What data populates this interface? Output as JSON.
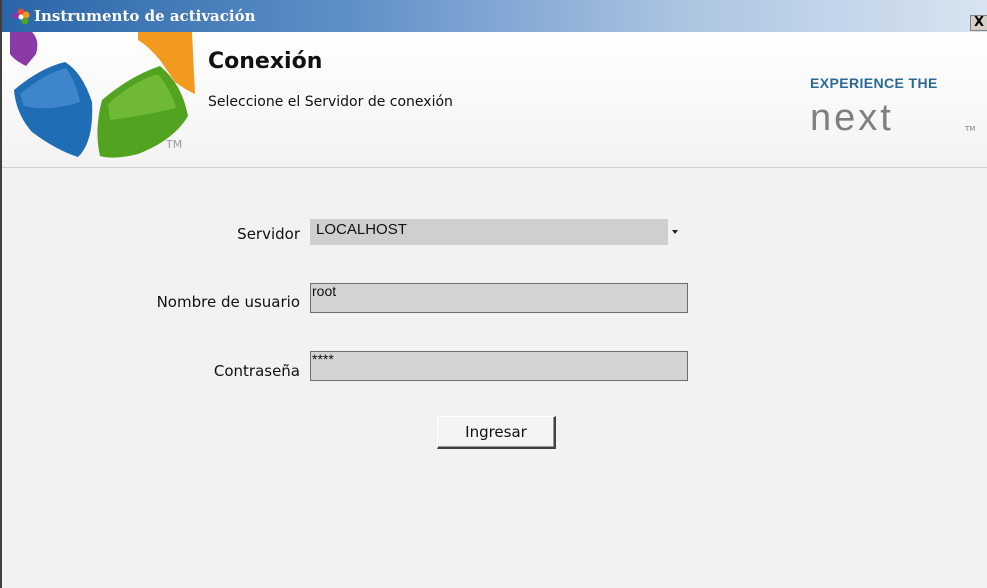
{
  "window": {
    "title": "Instrumento de activación",
    "close_label": "X"
  },
  "header": {
    "title": "Conexión",
    "subtitle": "Seleccione el Servidor de conexión",
    "tm": "TM",
    "brand_tagline": "EXPERIENCE THE",
    "brand_word": "next",
    "brand_tm": "TM"
  },
  "form": {
    "server_label": "Servidor",
    "server_value": "LOCALHOST",
    "username_label": "Nombre de usuario",
    "username_value": "root",
    "password_label": "Contraseña",
    "password_value": "****",
    "submit_label": "Ingresar"
  },
  "icons": {
    "title": "app-flower-icon",
    "dropdown": "chevron-down-icon"
  },
  "colors": {
    "brand_blue": "#2a6a96",
    "logo_blue": "#1f6db5",
    "logo_green": "#52a320",
    "logo_orange": "#f39a1e",
    "logo_purple": "#8a3aa6"
  }
}
